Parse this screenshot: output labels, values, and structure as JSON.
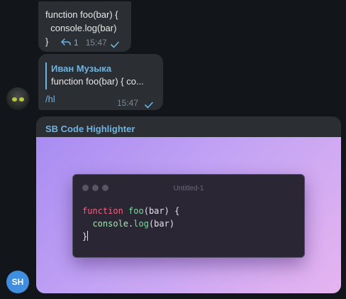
{
  "messages": [
    {
      "code_lines": [
        "function foo(bar) {",
        "  console.log(bar)",
        "}"
      ],
      "reply_count": "1",
      "time": "15:47"
    },
    {
      "reply_author": "Иван Музыка",
      "reply_snippet": "function foo(bar) {   co...",
      "text": "/hl",
      "time": "15:47"
    },
    {
      "sender_name": "SB Code Highlighter",
      "window_title": "Untitled-1",
      "code": {
        "line1": {
          "keyword": "function",
          "name": "foo",
          "open": "(",
          "param": "bar",
          "close": ") {"
        },
        "line2": {
          "indent": "  ",
          "object": "console",
          "dot": ".",
          "method": "log",
          "args": "(bar)"
        },
        "line3": "}"
      },
      "sender_initials": "SH"
    }
  ],
  "colors": {
    "background": "#121519",
    "bubble": "#2b2f33",
    "accent": "#6cb4e4",
    "avatar_sh": "#3f8ee0"
  },
  "icons": [
    "reply-arrow-icon",
    "read-check-icon"
  ]
}
